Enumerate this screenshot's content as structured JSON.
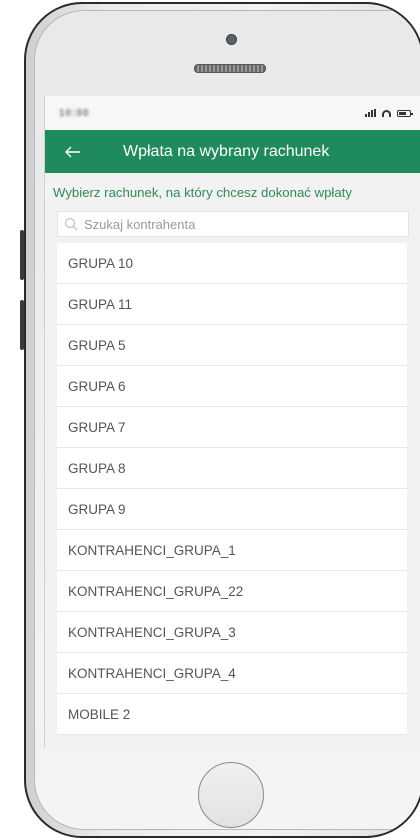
{
  "status_bar": {
    "time": "10:00"
  },
  "app_bar": {
    "back_icon": "arrow-left-icon",
    "title": "Wpłata na wybrany rachunek",
    "background_color": "#1f8a5c"
  },
  "instruction": "Wybierz rachunek, na który chcesz dokonać wpłaty",
  "search": {
    "icon": "search-icon",
    "placeholder": "Szukaj kontrahenta"
  },
  "accounts": [
    {
      "label": "GRUPA 10"
    },
    {
      "label": "GRUPA 11"
    },
    {
      "label": "GRUPA 5"
    },
    {
      "label": "GRUPA 6"
    },
    {
      "label": "GRUPA 7"
    },
    {
      "label": "GRUPA 8"
    },
    {
      "label": "GRUPA 9"
    },
    {
      "label": "KONTRAHENCI_GRUPA_1"
    },
    {
      "label": "KONTRAHENCI_GRUPA_22"
    },
    {
      "label": "KONTRAHENCI_GRUPA_3"
    },
    {
      "label": "KONTRAHENCI_GRUPA_4"
    },
    {
      "label": "MOBILE 2"
    }
  ]
}
